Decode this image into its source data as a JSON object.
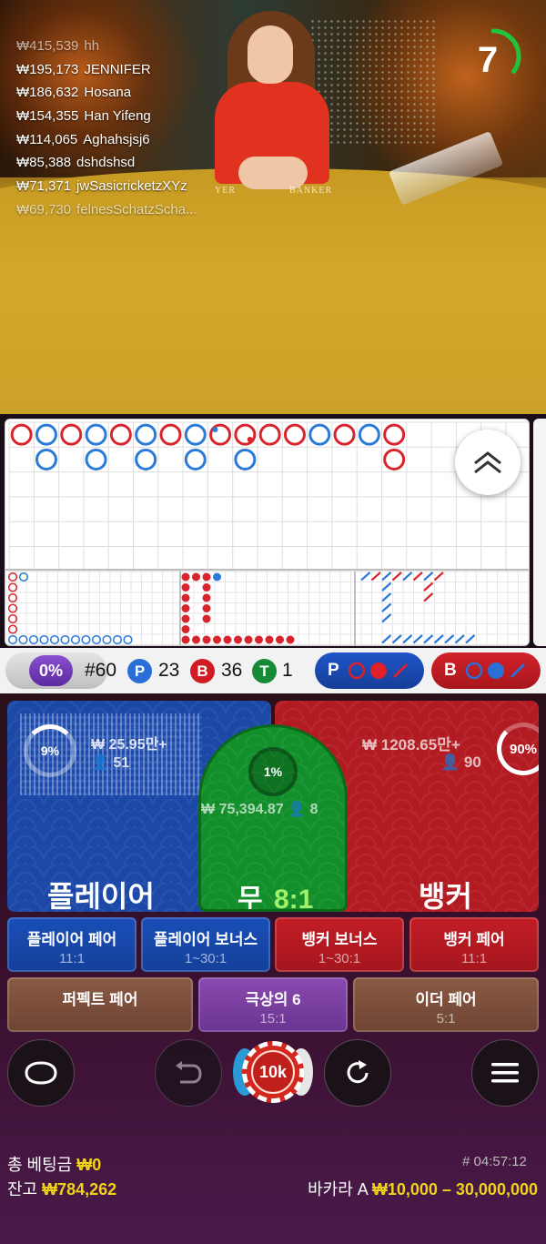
{
  "winners": [
    {
      "amount": "₩415,539",
      "name": "hh"
    },
    {
      "amount": "₩195,173",
      "name": "JENNIFER"
    },
    {
      "amount": "₩186,632",
      "name": "Hosana"
    },
    {
      "amount": "₩154,355",
      "name": "Han Yifeng"
    },
    {
      "amount": "₩114,065",
      "name": "Aghahsjsj6"
    },
    {
      "amount": "₩85,388",
      "name": "dshdshsd"
    },
    {
      "amount": "₩71,371",
      "name": "jwSasicricketzXYz"
    },
    {
      "amount": "₩69,730",
      "name": "felnesSchatzScha..."
    }
  ],
  "table_print": {
    "player": "YER",
    "banker": "BANKER"
  },
  "timer": {
    "seconds": "7",
    "remaining_fraction": 0.35,
    "color": "#1fc43a"
  },
  "roadmap": {
    "big_road_top": [
      "B",
      "P",
      "B",
      "P",
      "B",
      "P",
      "B",
      "P",
      "B",
      "B",
      "B",
      "B",
      "P",
      "B",
      "P",
      "B"
    ],
    "big_road_second": {
      "1": "P",
      "3": "P",
      "5": "P",
      "7": "P",
      "9": "P",
      "15": "B"
    }
  },
  "stats": {
    "percent": "0%",
    "round_label": "#60",
    "player_letter": "P",
    "player_count": "23",
    "banker_letter": "B",
    "banker_count": "36",
    "tie_letter": "T",
    "tie_count": "1",
    "player_predict_label": "P",
    "banker_predict_label": "B"
  },
  "colors": {
    "player": "#1c48a8",
    "banker": "#b21b22",
    "tie": "#128f2a",
    "gold": "#f0d21a",
    "accent_purple": "#7a3fc0"
  },
  "player": {
    "label": "플레이어",
    "pct": "9%",
    "amount": "₩ 25.95만+",
    "bettors": "51"
  },
  "tie": {
    "label": "무",
    "odds": "8:1",
    "pct": "1%",
    "amount": "₩ 75,394.87",
    "bettors": "8"
  },
  "banker": {
    "label": "뱅커",
    "pct": "90%",
    "amount": "₩ 1208.65만+",
    "bettors": "90"
  },
  "side_bets": [
    {
      "name": "플레이어 페어",
      "odds": "11:1"
    },
    {
      "name": "플레이어 보너스",
      "odds": "1~30:1"
    },
    {
      "name": "뱅커 보너스",
      "odds": "1~30:1"
    },
    {
      "name": "뱅커 페어",
      "odds": "11:1"
    },
    {
      "name": "퍼펙트 페어",
      "odds": ""
    },
    {
      "name": "극상의 6",
      "odds": "15:1"
    },
    {
      "name": "이더 페어",
      "odds": "5:1"
    }
  ],
  "chip": {
    "value": "10k"
  },
  "controls": {
    "chat": "chat-icon",
    "undo": "undo-icon",
    "repeat": "repeat-icon",
    "menu": "menu-icon"
  },
  "footer": {
    "total_bet_label": "총 베팅금",
    "total_bet_value": "₩0",
    "balance_label": "잔고",
    "balance_value": "₩784,262",
    "round_id": "# 04:57:12",
    "table_name": "바카라 A",
    "limits": "₩10,000 – 30,000,000"
  }
}
